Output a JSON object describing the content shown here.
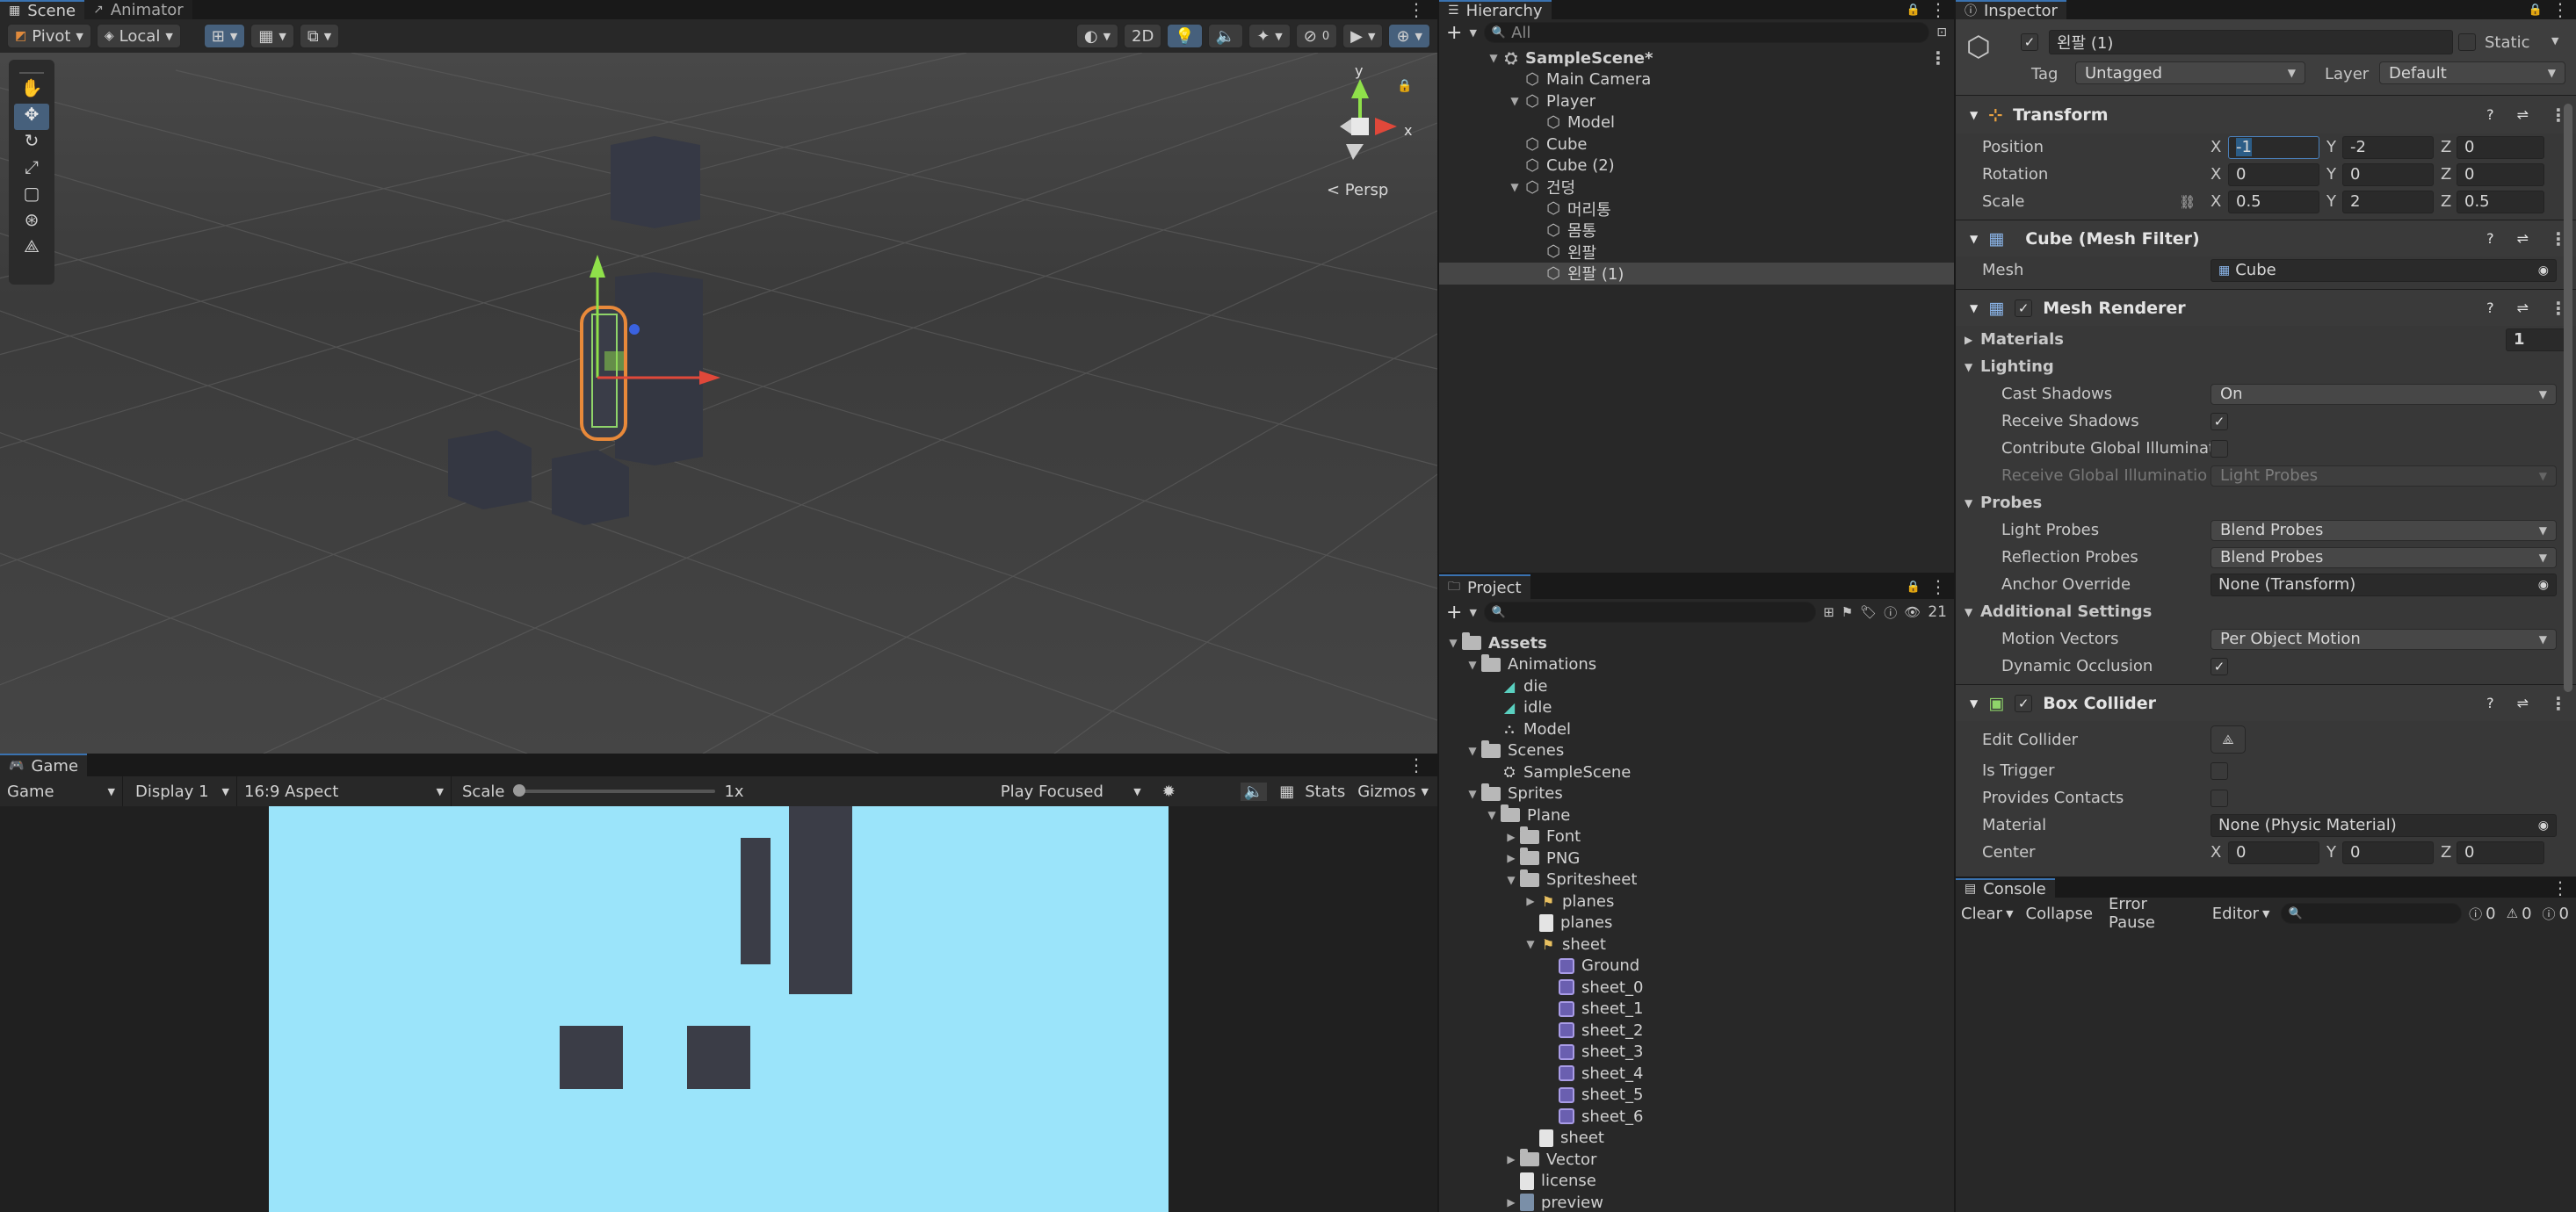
{
  "scene_tabs": {
    "scene": "Scene",
    "animator": "Animator"
  },
  "scene_toolbar": {
    "pivot": "Pivot",
    "local": "Local",
    "mode_2d": "2D"
  },
  "gizmo": {
    "y": "y",
    "x": "x",
    "persp": "< Persp"
  },
  "game_tab": {
    "title": "Game"
  },
  "game_toolbar": {
    "game": "Game",
    "display": "Display 1",
    "aspect": "16:9 Aspect",
    "scale_label": "Scale",
    "scale_value": "1x",
    "play_focused": "Play Focused",
    "stats": "Stats",
    "gizmos": "Gizmos"
  },
  "hierarchy": {
    "title": "Hierarchy",
    "search_placeholder": "All",
    "scene": "SampleScene*",
    "items": [
      {
        "label": "Main Camera",
        "depth": 1,
        "arrow": ""
      },
      {
        "label": "Player",
        "depth": 1,
        "arrow": "▼"
      },
      {
        "label": "Model",
        "depth": 2,
        "arrow": ""
      },
      {
        "label": "Cube",
        "depth": 1,
        "arrow": ""
      },
      {
        "label": "Cube (2)",
        "depth": 1,
        "arrow": ""
      },
      {
        "label": "건덩",
        "depth": 1,
        "arrow": "▼"
      },
      {
        "label": "머리통",
        "depth": 2,
        "arrow": ""
      },
      {
        "label": "몸통",
        "depth": 2,
        "arrow": ""
      },
      {
        "label": "왼팔",
        "depth": 2,
        "arrow": ""
      },
      {
        "label": "왼팔 (1)",
        "depth": 2,
        "arrow": ""
      }
    ]
  },
  "project": {
    "title": "Project",
    "badge": "21",
    "items": [
      {
        "label": "Assets",
        "depth": 0,
        "arrow": "▼",
        "icon": "folder",
        "bold": true
      },
      {
        "label": "Animations",
        "depth": 1,
        "arrow": "▼",
        "icon": "folder"
      },
      {
        "label": "die",
        "depth": 2,
        "arrow": "",
        "icon": "anim"
      },
      {
        "label": "idle",
        "depth": 2,
        "arrow": "",
        "icon": "anim"
      },
      {
        "label": "Model",
        "depth": 2,
        "arrow": "",
        "icon": "controller"
      },
      {
        "label": "Scenes",
        "depth": 1,
        "arrow": "▼",
        "icon": "folder"
      },
      {
        "label": "SampleScene",
        "depth": 2,
        "arrow": "",
        "icon": "scene"
      },
      {
        "label": "Sprites",
        "depth": 1,
        "arrow": "▼",
        "icon": "folder"
      },
      {
        "label": "Plane",
        "depth": 2,
        "arrow": "▼",
        "icon": "folder"
      },
      {
        "label": "Font",
        "depth": 3,
        "arrow": "▶",
        "icon": "folder"
      },
      {
        "label": "PNG",
        "depth": 3,
        "arrow": "▶",
        "icon": "folder"
      },
      {
        "label": "Spritesheet",
        "depth": 3,
        "arrow": "▼",
        "icon": "folder"
      },
      {
        "label": "planes",
        "depth": 4,
        "arrow": "▶",
        "icon": "atlas"
      },
      {
        "label": "planes",
        "depth": 4,
        "arrow": "",
        "icon": "file"
      },
      {
        "label": "sheet",
        "depth": 4,
        "arrow": "▼",
        "icon": "atlas"
      },
      {
        "label": "Ground",
        "depth": 5,
        "arrow": "",
        "icon": "sprite"
      },
      {
        "label": "sheet_0",
        "depth": 5,
        "arrow": "",
        "icon": "sprite"
      },
      {
        "label": "sheet_1",
        "depth": 5,
        "arrow": "",
        "icon": "sprite"
      },
      {
        "label": "sheet_2",
        "depth": 5,
        "arrow": "",
        "icon": "sprite"
      },
      {
        "label": "sheet_3",
        "depth": 5,
        "arrow": "",
        "icon": "sprite"
      },
      {
        "label": "sheet_4",
        "depth": 5,
        "arrow": "",
        "icon": "sprite"
      },
      {
        "label": "sheet_5",
        "depth": 5,
        "arrow": "",
        "icon": "sprite"
      },
      {
        "label": "sheet_6",
        "depth": 5,
        "arrow": "",
        "icon": "sprite"
      },
      {
        "label": "sheet",
        "depth": 4,
        "arrow": "",
        "icon": "file"
      },
      {
        "label": "Vector",
        "depth": 3,
        "arrow": "▶",
        "icon": "folder"
      },
      {
        "label": "license",
        "depth": 3,
        "arrow": "",
        "icon": "file"
      },
      {
        "label": "preview",
        "depth": 3,
        "arrow": "▶",
        "icon": "image"
      }
    ]
  },
  "inspector": {
    "title": "Inspector",
    "object_name": "왼팔 (1)",
    "static_label": "Static",
    "tag_label": "Tag",
    "tag_value": "Untagged",
    "layer_label": "Layer",
    "layer_value": "Default",
    "transform": {
      "title": "Transform",
      "position_label": "Position",
      "pos_x": "-1",
      "pos_y": "-2",
      "pos_z": "0",
      "rotation_label": "Rotation",
      "rot_x": "0",
      "rot_y": "0",
      "rot_z": "0",
      "scale_label": "Scale",
      "scale_x": "0.5",
      "scale_y": "2",
      "scale_z": "0.5"
    },
    "mesh_filter": {
      "title": "Cube (Mesh Filter)",
      "mesh_label": "Mesh",
      "mesh_value": "Cube"
    },
    "mesh_renderer": {
      "title": "Mesh Renderer",
      "materials_label": "Materials",
      "materials_count": "1",
      "lighting_label": "Lighting",
      "cast_shadows_label": "Cast Shadows",
      "cast_shadows_value": "On",
      "receive_shadows_label": "Receive Shadows",
      "contribute_gi_label": "Contribute Global Illuminati",
      "receive_gi_label": "Receive Global Illuminatio",
      "receive_gi_value": "Light Probes",
      "probes_label": "Probes",
      "light_probes_label": "Light Probes",
      "light_probes_value": "Blend Probes",
      "reflection_probes_label": "Reflection Probes",
      "reflection_probes_value": "Blend Probes",
      "anchor_override_label": "Anchor Override",
      "anchor_override_value": "None (Transform)",
      "additional_label": "Additional Settings",
      "motion_vectors_label": "Motion Vectors",
      "motion_vectors_value": "Per Object Motion",
      "dynamic_occlusion_label": "Dynamic Occlusion"
    },
    "box_collider": {
      "title": "Box Collider",
      "edit_collider_label": "Edit Collider",
      "is_trigger_label": "Is Trigger",
      "provides_contacts_label": "Provides Contacts",
      "material_label": "Material",
      "material_value": "None (Physic Material)",
      "center_label": "Center",
      "center_x": "0",
      "center_y": "0",
      "center_z": "0"
    }
  },
  "console": {
    "title": "Console",
    "clear": "Clear",
    "collapse": "Collapse",
    "error_pause": "Error Pause",
    "editor": "Editor",
    "count_info": "0",
    "count_warn": "0",
    "count_error": "0"
  },
  "axis_labels": {
    "x": "X",
    "y": "Y",
    "z": "Z"
  },
  "colors": {
    "accent": "#3a72b0",
    "selection": "#2c5d87",
    "game_sky": "#9be4fa",
    "game_block": "#3b3d47"
  }
}
